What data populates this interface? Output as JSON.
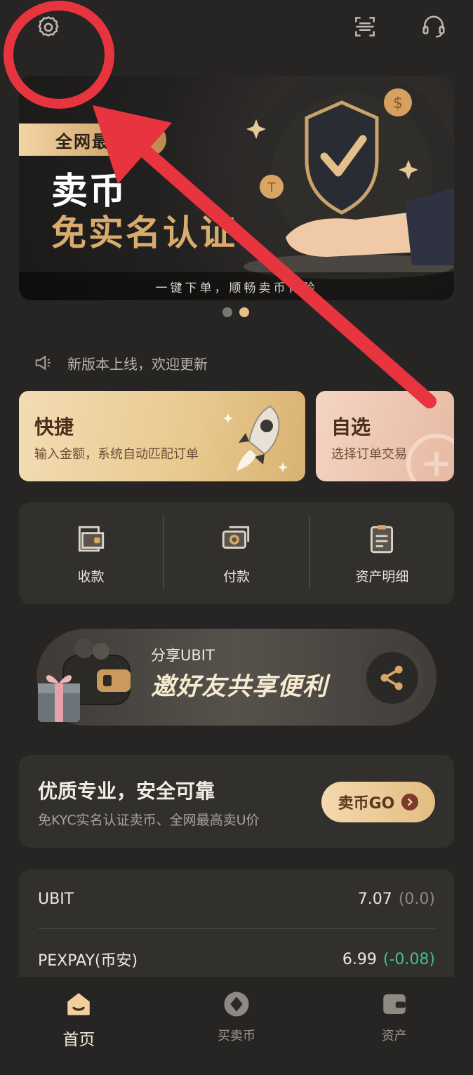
{
  "header": {
    "settings_icon": "gear-icon",
    "scan_icon": "scan-icon",
    "support_icon": "headset-icon"
  },
  "banner": {
    "tag": "全网最",
    "title_line1": "卖币",
    "title_line2": "免实名认证",
    "footer": "一键下单，顺畅卖币体验",
    "dots_active_index": 1
  },
  "notice": {
    "icon": "speaker-icon",
    "text": "新版本上线，欢迎更新"
  },
  "trade_cards": {
    "quick": {
      "title": "快捷",
      "subtitle": "输入金额，系统自动匹配订单"
    },
    "self": {
      "title": "自选",
      "subtitle": "选择订单交易"
    }
  },
  "actions": [
    {
      "label": "收款",
      "icon": "wallet-icon"
    },
    {
      "label": "付款",
      "icon": "payment-icon"
    },
    {
      "label": "资产明细",
      "icon": "clipboard-icon"
    }
  ],
  "share": {
    "subtitle": "分享UBIT",
    "title": "邀好友共享便利",
    "icon": "share-icon"
  },
  "promo": {
    "title": "优质专业，安全可靠",
    "subtitle": "免KYC实名认证卖币、全网最高卖U价",
    "button": "卖币GO"
  },
  "rates": [
    {
      "name": "UBIT",
      "value": "7.07",
      "change": "(0.0)",
      "change_color": "#8e8a83"
    },
    {
      "name": "PEXPAY(币安)",
      "value": "6.99",
      "change": "(-0.08)",
      "change_color": "#3fbf8f"
    }
  ],
  "bottom_nav": [
    {
      "label": "首页",
      "icon": "home-icon",
      "active": true
    },
    {
      "label": "买卖币",
      "icon": "trade-icon",
      "active": false
    },
    {
      "label": "资产",
      "icon": "wallet-icon",
      "active": false
    }
  ],
  "colors": {
    "background": "#262524",
    "card": "#32302d",
    "accent_gold": "#e3bd82",
    "annotation_red": "#e8343f"
  }
}
